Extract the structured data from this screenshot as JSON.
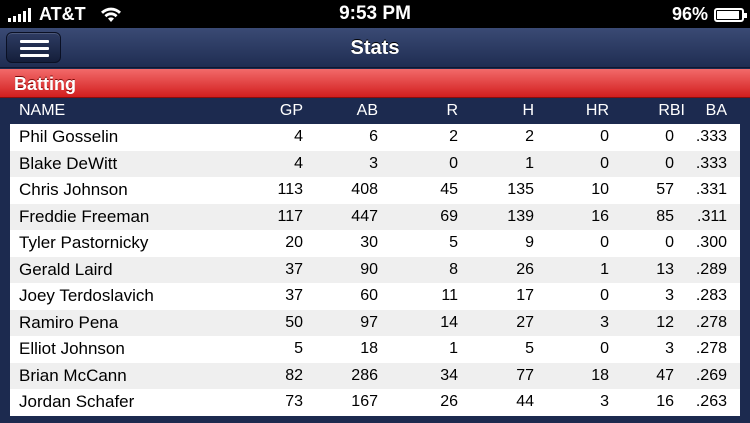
{
  "status_bar": {
    "carrier": "AT&T",
    "time": "9:53 PM",
    "battery": "96%"
  },
  "nav": {
    "title": "Stats"
  },
  "section": {
    "title": "Batting"
  },
  "table": {
    "columns": [
      "NAME",
      "GP",
      "AB",
      "R",
      "H",
      "HR",
      "RBI",
      "BA"
    ],
    "rows": [
      [
        "Phil Gosselin",
        "4",
        "6",
        "2",
        "2",
        "0",
        "0",
        ".333"
      ],
      [
        "Blake DeWitt",
        "4",
        "3",
        "0",
        "1",
        "0",
        "0",
        ".333"
      ],
      [
        "Chris Johnson",
        "113",
        "408",
        "45",
        "135",
        "10",
        "57",
        ".331"
      ],
      [
        "Freddie Freeman",
        "117",
        "447",
        "69",
        "139",
        "16",
        "85",
        ".311"
      ],
      [
        "Tyler Pastornicky",
        "20",
        "30",
        "5",
        "9",
        "0",
        "0",
        ".300"
      ],
      [
        "Gerald Laird",
        "37",
        "90",
        "8",
        "26",
        "1",
        "13",
        ".289"
      ],
      [
        "Joey Terdoslavich",
        "37",
        "60",
        "11",
        "17",
        "0",
        "3",
        ".283"
      ],
      [
        "Ramiro Pena",
        "50",
        "97",
        "14",
        "27",
        "3",
        "12",
        ".278"
      ],
      [
        "Elliot Johnson",
        "5",
        "18",
        "1",
        "5",
        "0",
        "3",
        ".278"
      ],
      [
        "Brian McCann",
        "82",
        "286",
        "34",
        "77",
        "18",
        "47",
        ".269"
      ],
      [
        "Jordan Schafer",
        "73",
        "167",
        "26",
        "44",
        "3",
        "16",
        ".263"
      ]
    ]
  },
  "colors": {
    "nav_bg": "#2a3961",
    "section_red": "#e23a3a",
    "table_header_bg": "#1c2a4f",
    "row_even": "#efefef"
  },
  "icons": {
    "menu": "hamburger-icon",
    "signal": "signal-icon",
    "wifi": "wifi-icon",
    "battery": "battery-icon"
  }
}
